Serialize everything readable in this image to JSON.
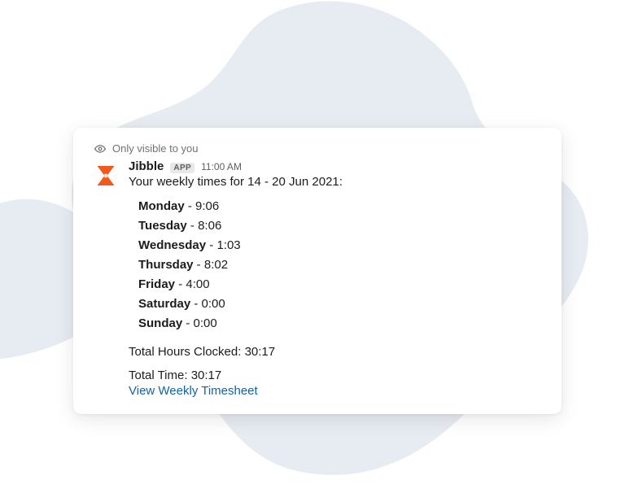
{
  "visibility_text": "Only visible to you",
  "app": {
    "name": "Jibble",
    "badge": "APP",
    "timestamp": "11:00 AM"
  },
  "intro": "Your weekly times for 14 - 20 Jun 2021:",
  "days": [
    {
      "label": "Monday",
      "value": "9:06"
    },
    {
      "label": "Tuesday",
      "value": "8:06"
    },
    {
      "label": "Wednesday",
      "value": "1:03"
    },
    {
      "label": "Thursday",
      "value": "8:02"
    },
    {
      "label": "Friday",
      "value": "4:00"
    },
    {
      "label": "Saturday",
      "value": "0:00"
    },
    {
      "label": "Sunday",
      "value": "0:00"
    }
  ],
  "total_hours_label": "Total Hours Clocked:",
  "total_hours_value": "30:17",
  "total_time_label": "Total Time:",
  "total_time_value": "30:17",
  "link_text": "View Weekly Timesheet",
  "colors": {
    "blob": "#e7ebf2",
    "accent": "#f05a1a",
    "link": "#1264a3"
  }
}
